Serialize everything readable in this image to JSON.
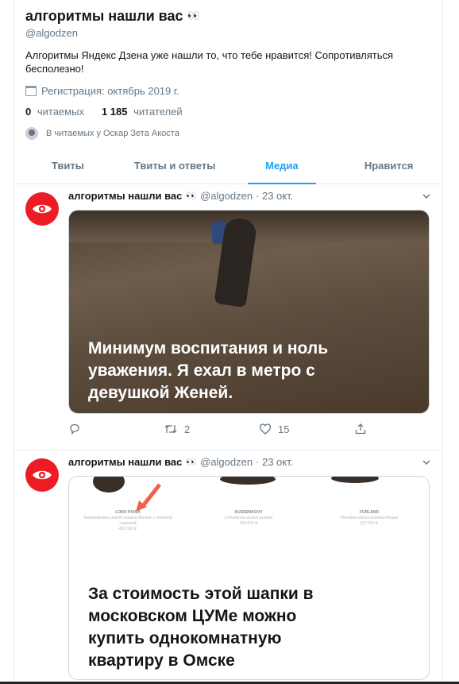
{
  "profile": {
    "name": "алгоритмы нашли вас",
    "emoji": "👀",
    "handle": "@algodzen",
    "bio": "Алгоритмы Яндекс Дзена уже нашли то, что тебе нравится!  Сопротивляться бесполезно!",
    "joined": "Регистрация: октябрь 2019 г.",
    "following_count": "0",
    "following_label": "читаемых",
    "followers_count": "1 185",
    "followers_label": "читателей",
    "followed_by": "В читаемых у Оскар Зета Акоста"
  },
  "tabs": [
    {
      "label": "Твиты"
    },
    {
      "label": "Твиты и ответы"
    },
    {
      "label": "Медиа"
    },
    {
      "label": "Нравится"
    }
  ],
  "active_tab": "Медиа",
  "tweets": [
    {
      "author": "алгоритмы нашли вас",
      "emoji": "👀",
      "handle": "@algodzen",
      "date": "· 23 окт.",
      "image_caption": "Минимум воспитания и ноль уважения. Я ехал в метро с девушкой Женей.",
      "replies": "",
      "retweets": "2",
      "likes": "15"
    },
    {
      "author": "алгоритмы нашли вас",
      "emoji": "👀",
      "handle": "@algodzen",
      "date": "· 23 окт.",
      "image_caption": "За стоимость этой шапки в московском ЦУМе можно купить однокомнатную квартиру в Омске",
      "products": [
        {
          "brand": "LORO PIANA",
          "desc": "Кашемировая шапка-ушанка Alaskan с меховой отделкой",
          "price": "492 000 ₽"
        },
        {
          "brand": "KUSSENKOVV",
          "desc": "Соболиная шапка-ушанка",
          "price": "369 600 ₽"
        },
        {
          "brand": "FURLAND",
          "desc": "Меховая шапка-ушанка Мишка",
          "price": "337 000 ₽"
        }
      ]
    }
  ],
  "colors": {
    "accent": "#1da1f2",
    "avatar_bg": "#ed1c24",
    "muted": "#657786"
  }
}
